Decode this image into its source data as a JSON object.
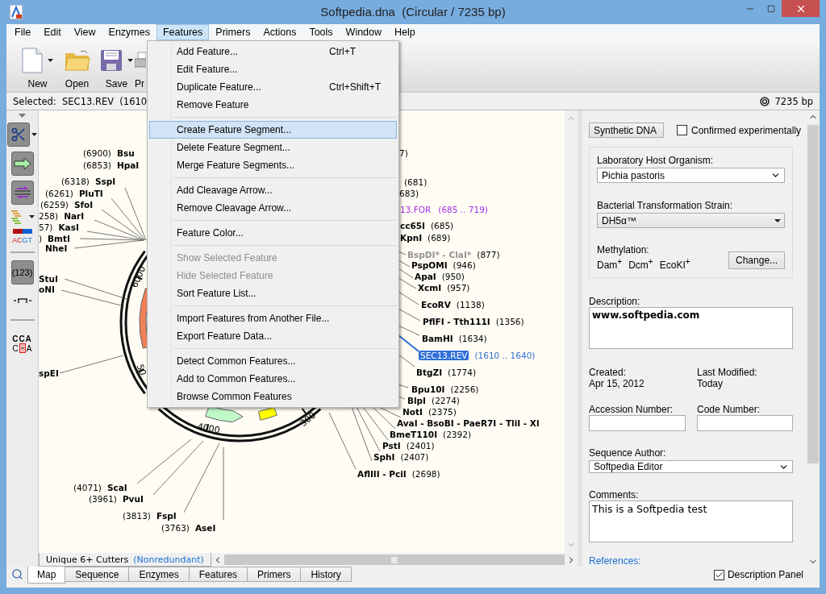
{
  "window": {
    "title": "Softpedia.dna  (Circular / 7235 bp)"
  },
  "menu_bar": [
    {
      "label": "File",
      "selected": false
    },
    {
      "label": "Edit",
      "selected": false
    },
    {
      "label": "View",
      "selected": false
    },
    {
      "label": "Enzymes",
      "selected": false
    },
    {
      "label": "Features",
      "selected": true
    },
    {
      "label": "Primers",
      "selected": false
    },
    {
      "label": "Actions",
      "selected": false
    },
    {
      "label": "Tools",
      "selected": false
    },
    {
      "label": "Window",
      "selected": false
    },
    {
      "label": "Help",
      "selected": false
    }
  ],
  "features_menu": {
    "groups": [
      [
        {
          "label": "Add Feature...",
          "shortcut": "Ctrl+T",
          "highlighted": false,
          "disabled": false
        },
        {
          "label": "Edit Feature...",
          "highlighted": false,
          "disabled": false
        },
        {
          "label": "Duplicate Feature...",
          "shortcut": "Ctrl+Shift+T",
          "highlighted": false,
          "disabled": false
        },
        {
          "label": "Remove Feature",
          "highlighted": false,
          "disabled": false
        }
      ],
      [
        {
          "label": "Create Feature Segment...",
          "highlighted": true,
          "disabled": false
        },
        {
          "label": "Delete Feature Segment...",
          "highlighted": false,
          "disabled": false
        },
        {
          "label": "Merge Feature Segments...",
          "highlighted": false,
          "disabled": false
        }
      ],
      [
        {
          "label": "Add Cleavage Arrow...",
          "highlighted": false,
          "disabled": false
        },
        {
          "label": "Remove Cleavage Arrow...",
          "highlighted": false,
          "disabled": false
        }
      ],
      [
        {
          "label": "Feature Color...",
          "highlighted": false,
          "disabled": false
        }
      ],
      [
        {
          "label": "Show Selected Feature",
          "highlighted": false,
          "disabled": true
        },
        {
          "label": "Hide Selected Feature",
          "highlighted": false,
          "disabled": true
        },
        {
          "label": "Sort Feature List...",
          "highlighted": false,
          "disabled": false
        }
      ],
      [
        {
          "label": "Import Features from Another File...",
          "highlighted": false,
          "disabled": false
        },
        {
          "label": "Export Feature Data...",
          "highlighted": false,
          "disabled": false
        }
      ],
      [
        {
          "label": "Detect Common Features...",
          "highlighted": false,
          "disabled": false
        },
        {
          "label": "Add to Common Features...",
          "highlighted": false,
          "disabled": false
        },
        {
          "label": "Browse Common Features",
          "highlighted": false,
          "disabled": false
        }
      ]
    ]
  },
  "toolbar": [
    {
      "label": "New",
      "kind": "new",
      "dropdown": true
    },
    {
      "label": "Open",
      "kind": "open",
      "dropdown": false
    },
    {
      "label": "Save",
      "kind": "save",
      "dropdown": true
    },
    {
      "label": "Pr",
      "kind": "print"
    }
  ],
  "selection_bar": {
    "text": "Selected:  SEC13.REV  (1610",
    "length": "7235 bp"
  },
  "tool_strip": [
    {
      "kind": "scissors"
    },
    {
      "kind": "arrow"
    },
    {
      "kind": "strands"
    },
    {
      "kind": "bars"
    },
    {
      "kind": "colors",
      "label": "ACGT"
    },
    {
      "kind": "numbers",
      "label": "(123)"
    },
    {
      "kind": "ruler"
    },
    {
      "kind": "codon",
      "top": "CCA",
      "left": "C",
      "right": "A"
    }
  ],
  "map": {
    "ticks": [
      "6000",
      "50",
      "4000",
      "300"
    ],
    "left_labels": [
      {
        "position": "(6900)",
        "name": "Bsu"
      },
      {
        "position": "(6853)",
        "name": "HpaI"
      },
      {
        "position": "(6318)",
        "name": "SspI"
      },
      {
        "position": "(6261)",
        "name": "PluTI"
      },
      {
        "position": "(6259)",
        "name": "SfoI"
      },
      {
        "position": "258)",
        "name": "NarI"
      },
      {
        "position": "57)",
        "name": "KasI"
      },
      {
        "position": ")",
        "name": "BmtI"
      },
      {
        "name": "NheI"
      },
      {
        "name": "StuI"
      },
      {
        "name": "oNI"
      },
      {
        "name": "spEI"
      },
      {
        "position": "(4071)",
        "name": "ScaI"
      },
      {
        "position": "(3961)",
        "name": "PvuI"
      },
      {
        "position": "(3813)",
        "name": "FspI"
      },
      {
        "position": "(3763)",
        "name": "AseI"
      }
    ],
    "right_labels": [
      {
        "kind": "enzyme",
        "position": "7)"
      },
      {
        "kind": "enzyme",
        "position": "(681)"
      },
      {
        "kind": "enzyme",
        "position": "683)"
      },
      {
        "kind": "feature",
        "name": "13.FOR",
        "position": "(685 .. 719)",
        "color": "#a030e8",
        "selected": false
      },
      {
        "kind": "enzyme",
        "name": "cc65I",
        "position": "(685)"
      },
      {
        "kind": "enzyme",
        "name": "KpnI",
        "position": "(689)"
      },
      {
        "kind": "blocked_enzyme",
        "name": "BspDI* - ClaI*",
        "position": "(877)"
      },
      {
        "kind": "enzyme",
        "name": "PspOMI",
        "position": "(946)"
      },
      {
        "kind": "enzyme",
        "name": "ApaI",
        "position": "(950)"
      },
      {
        "kind": "enzyme",
        "name": "XcmI",
        "position": "(957)"
      },
      {
        "kind": "enzyme",
        "name": "EcoRV",
        "position": "(1138)"
      },
      {
        "kind": "enzyme",
        "name": "PflFI - Tth111I",
        "position": "(1356)"
      },
      {
        "kind": "enzyme",
        "name": "BamHI",
        "position": "(1634)"
      },
      {
        "kind": "feature",
        "name": "SEC13.REV",
        "position": "(1610 .. 1640)",
        "color": "#2f6fd8",
        "selected": true
      },
      {
        "kind": "enzyme",
        "name": "BtgZI",
        "position": "(1774)"
      },
      {
        "kind": "enzyme",
        "name": "Bpu10I",
        "position": "(2256)"
      },
      {
        "kind": "enzyme",
        "name": "BlpI",
        "position": "(2274)"
      },
      {
        "kind": "enzyme",
        "name": "NotI",
        "position": "(2375)"
      },
      {
        "kind": "enzyme",
        "name": "AvaI - BsoBI - PaeR7I - TliI - Xl"
      },
      {
        "kind": "enzyme",
        "name": "BmeT110I",
        "position": "(2392)"
      },
      {
        "kind": "enzyme",
        "name": "PstI",
        "position": "(2401)"
      },
      {
        "kind": "enzyme",
        "name": "SphI",
        "position": "(2407)"
      },
      {
        "kind": "enzyme",
        "name": "AflIII - PciI",
        "position": "(2698)"
      }
    ],
    "bottom_tab": {
      "label": "Unique 6+ Cutters",
      "note": "(Nonredundant)"
    }
  },
  "description_panel": {
    "molecule_type": "Synthetic DNA",
    "confirmed": {
      "label": "Confirmed experimentally",
      "checked": false
    },
    "host_label": "Laboratory Host Organism:",
    "host": "Pichia pastoris",
    "strain_label": "Bacterial Transformation Strain:",
    "strain": "DH5α™",
    "methylation_label": "Methylation:",
    "methylation": [
      "Dam$^{+}$",
      "Dcm$^{+}$",
      "EcoKI$^{+}$"
    ],
    "change_button": "Change...",
    "description_label": "Description:",
    "description": "www.softpedia.com",
    "created_label": "Created:",
    "created": "Apr 15, 2012",
    "modified_label": "Last Modified:",
    "modified": "Today",
    "accession_label": "Accession Number:",
    "code_label": "Code Number:",
    "author_label": "Sequence Author:",
    "author": "Softpedia Editor",
    "comments_label": "Comments:",
    "comments": "This is a Softpedia test",
    "references_link": "References:"
  },
  "view_tabs": [
    {
      "label": "Map",
      "selected": true
    },
    {
      "label": "Sequence",
      "selected": false
    },
    {
      "label": "Enzymes",
      "selected": false
    },
    {
      "label": "Features",
      "selected": false
    },
    {
      "label": "Primers",
      "selected": false
    },
    {
      "label": "History",
      "selected": false
    }
  ],
  "description_panel_toggle": {
    "label": "Description Panel",
    "checked": true
  }
}
